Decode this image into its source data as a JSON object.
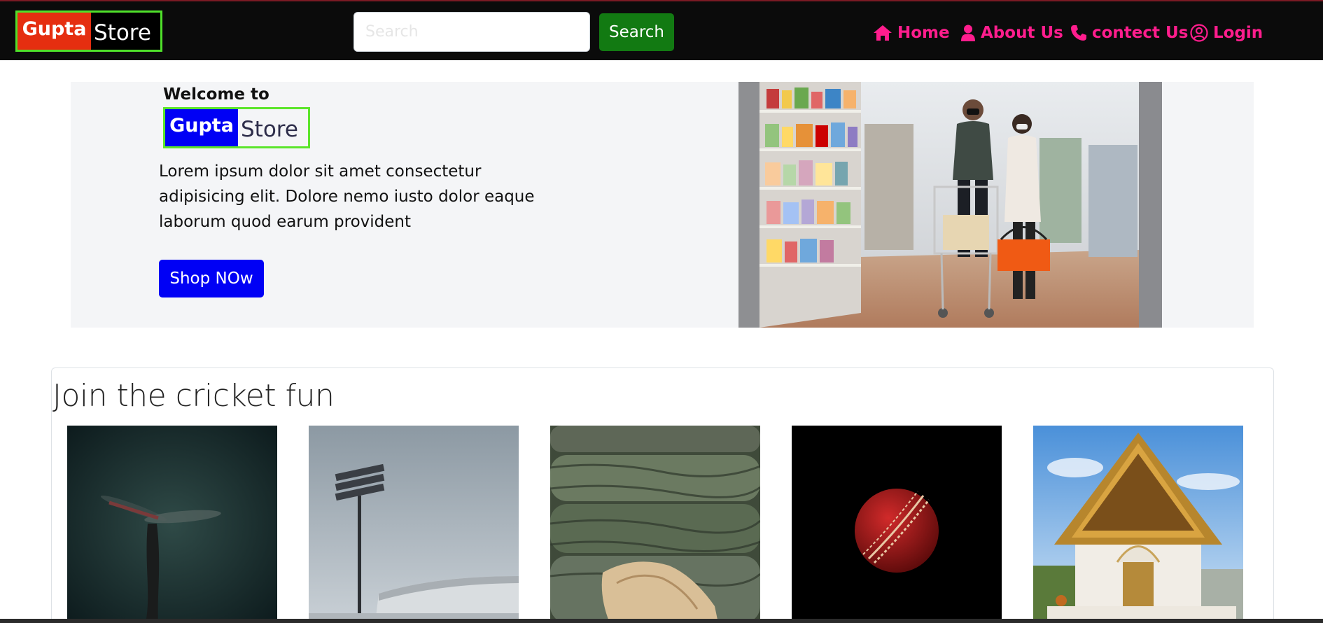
{
  "navbar": {
    "brand_highlight": "Gupta",
    "brand_rest": "Store",
    "search_placeholder": "Search",
    "search_button": "Search",
    "links": [
      {
        "label": "Home",
        "icon": "home-icon"
      },
      {
        "label": "About Us",
        "icon": "user-icon"
      },
      {
        "label": "contect Us",
        "icon": "phone-icon"
      },
      {
        "label": "Login",
        "icon": "user-circle-icon"
      }
    ],
    "link_color": "#ff1d8d"
  },
  "hero": {
    "welcome": "Welcome to",
    "brand_highlight": "Gupta",
    "brand_rest": "Store",
    "text": "Lorem ipsum dolor sit amet consectetur adipisicing elit. Dolore nemo iusto dolor eaque laborum quod earum provident",
    "shop_button": "Shop NOw",
    "image": "supermarket-couple-photo"
  },
  "section": {
    "title": "Join the cricket fun",
    "thumbnails": [
      "dragonfly-photo",
      "stadium-floodlight-photo",
      "logs-bark-photo",
      "cricket-ball-photo",
      "temple-photo"
    ]
  },
  "colors": {
    "navbar_bg": "#0b0b0b",
    "brand_red": "#e52e10",
    "brand_blue": "#0000f5",
    "brand_border": "#4fe02a",
    "search_green": "#127a12"
  }
}
